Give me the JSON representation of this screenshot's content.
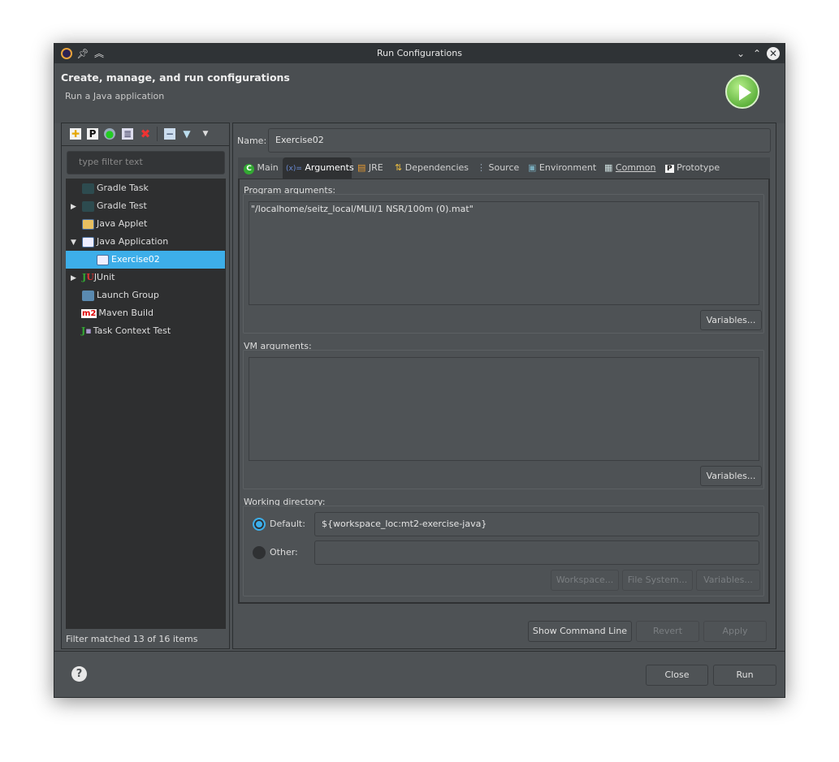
{
  "window": {
    "title": "Run Configurations"
  },
  "header": {
    "title": "Create, manage, and run configurations",
    "subtitle": "Run a Java application"
  },
  "left": {
    "filter_placeholder": "type filter text",
    "status": "Filter matched 13 of 16 items",
    "items": [
      {
        "label": "Gradle Task",
        "icon": "gradle-icon"
      },
      {
        "label": "Gradle Test",
        "icon": "gradle-icon"
      },
      {
        "label": "Java Applet",
        "icon": "java-applet-icon"
      },
      {
        "label": "Java Application",
        "icon": "java-application-icon"
      },
      {
        "label": "Exercise02",
        "icon": "java-application-icon"
      },
      {
        "label": "JUnit",
        "icon": "junit-icon"
      },
      {
        "label": "Launch Group",
        "icon": "launch-group-icon"
      },
      {
        "label": "Maven Build",
        "icon": "maven-icon"
      },
      {
        "label": "Task Context Test",
        "icon": "task-context-icon"
      }
    ]
  },
  "name": {
    "label": "Name:",
    "value": "Exercise02"
  },
  "tabs": [
    {
      "label": "Main"
    },
    {
      "label": "Arguments"
    },
    {
      "label": "JRE"
    },
    {
      "label": "Dependencies"
    },
    {
      "label": "Source"
    },
    {
      "label": "Environment"
    },
    {
      "label": "Common"
    },
    {
      "label": "Prototype"
    }
  ],
  "arguments": {
    "program_label": "Program arguments:",
    "program_value": "\"/localhome/seitz_local/MLII/1 NSR/100m (0).mat\"",
    "vm_label": "VM arguments:",
    "vm_value": "",
    "variables": "Variables...",
    "workdir_label": "Working directory:",
    "default_label": "Default:",
    "default_value": "${workspace_loc:mt2-exercise-java}",
    "other_label": "Other:",
    "other_value": "",
    "workspace": "Workspace...",
    "filesystem": "File System...",
    "variables2": "Variables..."
  },
  "buttons": {
    "show_cmd": "Show Command Line",
    "revert": "Revert",
    "apply": "Apply",
    "close": "Close",
    "run": "Run"
  },
  "colors": {
    "accent": "#3daee9",
    "selection": "#3daee9"
  }
}
